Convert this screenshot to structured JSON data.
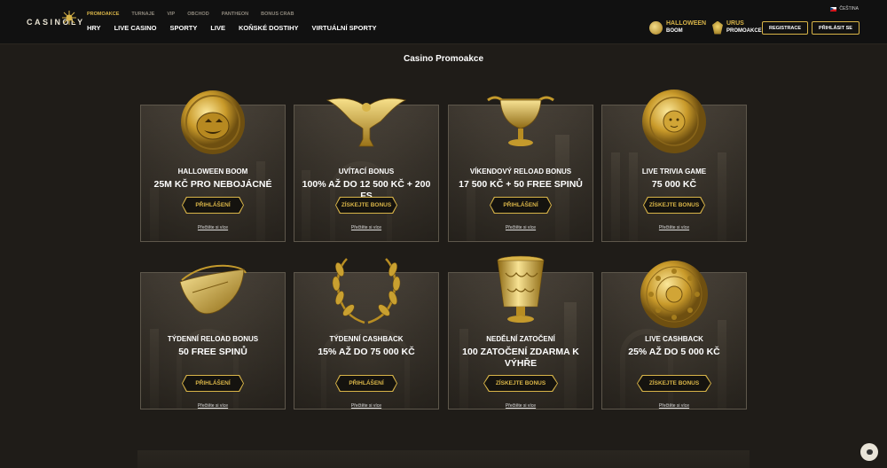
{
  "header": {
    "logo_text": "CASINOLY",
    "topnav": [
      "Promoakce",
      "Turnaje",
      "VIP",
      "Obchod",
      "Pantheon",
      "Bonus Crab"
    ],
    "mainnav": [
      "Hry",
      "Live Casino",
      "Sporty",
      "Live",
      "Koňské dostihy",
      "Virtuální sporty"
    ],
    "language": "ČEŠTINA",
    "promo1": {
      "line1": "HALLOWEEN",
      "line2": "BOOM",
      "icon": "pumpkin-icon"
    },
    "promo2": {
      "line1": "URUS",
      "line2": "PROMOAKCE",
      "icon": "bull-icon"
    },
    "register_label": "Registrace",
    "login_label": "Přihlásit se"
  },
  "page_title": "Casino Promoakce",
  "cards": [
    {
      "title": "Halloween Boom",
      "value": "25M KČ PRO NEBOJÁCNÉ",
      "button": "Přihlášení",
      "link": "Přečtěte si více",
      "icon": "pumpkin-shield-icon"
    },
    {
      "title": "Uvítací bonus",
      "value": "100% AŽ DO 12 500 KČ + 200 FS",
      "button": "Získejte bonus",
      "link": "Přečtěte si více",
      "icon": "eagle-icon"
    },
    {
      "title": "Víkendový reload bonus",
      "value": "17 500 KČ + 50 FREE SPINŮ",
      "button": "Přihlášení",
      "link": "Přečtěte si více",
      "icon": "chalice-icon"
    },
    {
      "title": "Live Trivia game",
      "value": "75 000 KČ",
      "button": "Získejte bonus",
      "link": "Přečtěte si více",
      "icon": "medusa-shield-icon"
    },
    {
      "title": "Týdenní reload bonus",
      "value": "50 FREE SPINŮ",
      "button": "Přihlášení",
      "link": "Přečtěte si více",
      "icon": "rhyton-icon"
    },
    {
      "title": "Týdenní cashback",
      "value": "15% AŽ DO 75 000 KČ",
      "button": "Přihlášení",
      "link": "Přečtěte si více",
      "icon": "laurel-wreath-icon"
    },
    {
      "title": "Nedělní zatočení",
      "value": "100 ZATOČENÍ ZDARMA K VÝHŘE",
      "button": "Získejte bonus",
      "link": "Přečtěte si více",
      "icon": "cup-icon"
    },
    {
      "title": "Live cashback",
      "value": "25% AŽ DO 5 000 KČ",
      "button": "Získejte bonus",
      "link": "Přečtěte si více",
      "icon": "coin-icon"
    }
  ],
  "colors": {
    "accent": "#d8b448",
    "background": "#1f1c18",
    "header": "#111111"
  }
}
